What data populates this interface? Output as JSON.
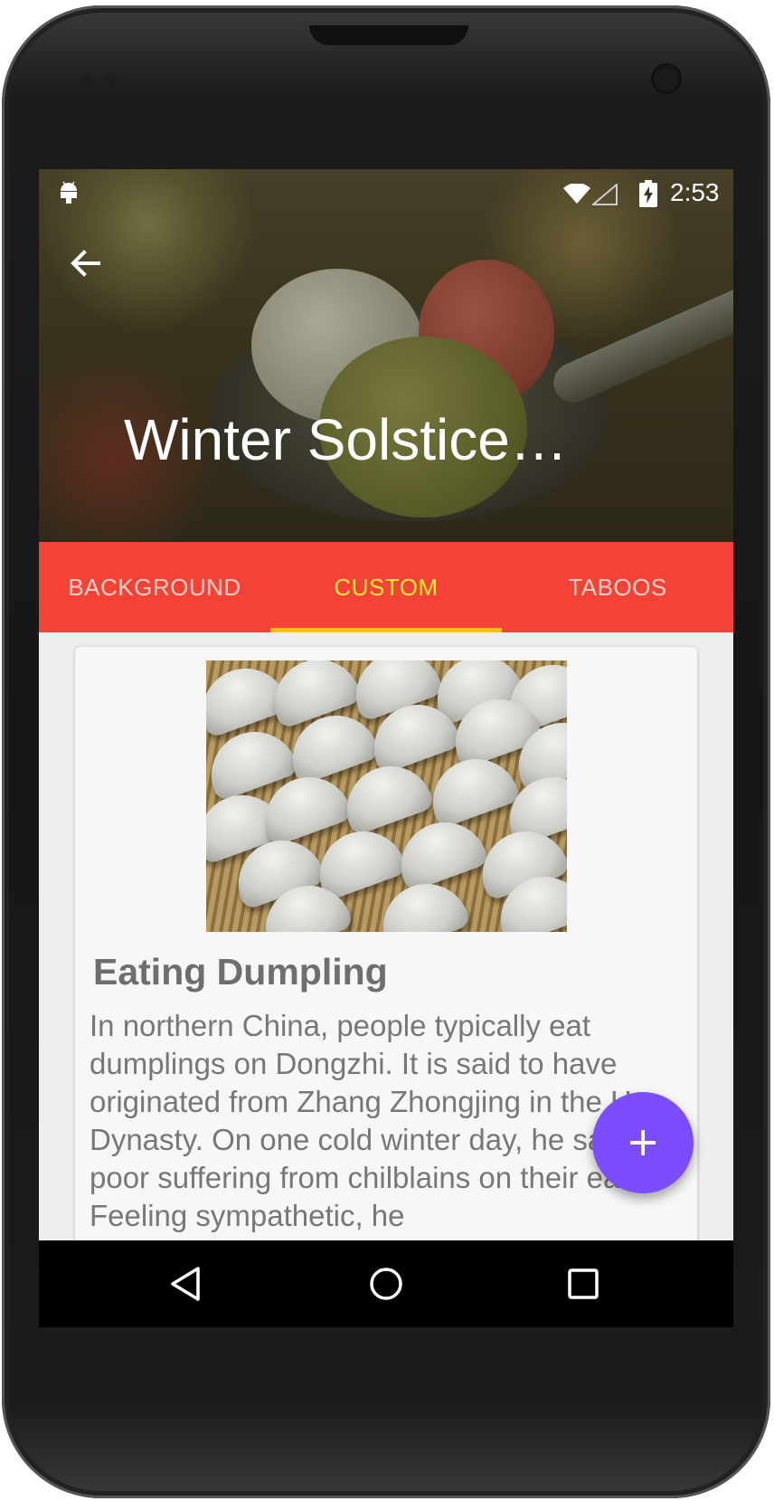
{
  "status_bar": {
    "time": "2:53"
  },
  "header": {
    "title": "Winter Solstice…"
  },
  "tabs": [
    {
      "label": "BACKGROUND",
      "active": false
    },
    {
      "label": "CUSTOM",
      "active": true
    },
    {
      "label": "TABOOS",
      "active": false
    }
  ],
  "card": {
    "title": "Eating Dumpling",
    "body": "In northern China, people typically eat dumplings on Dongzhi. It is said to have originated from Zhang Zhongjing in the Han Dynasty. On one cold winter day, he saw the poor suffering from chilblains on their ears. Feeling sympathetic, he"
  },
  "colors": {
    "primary": "#f44336",
    "accent": "#ffeb3b",
    "indicator": "#ffc107",
    "fab": "#7c4dff"
  },
  "icons": [
    "android-icon",
    "wifi-icon",
    "signal-icon",
    "battery-icon",
    "back-arrow-icon",
    "plus-icon",
    "nav-back-icon",
    "nav-home-icon",
    "nav-recents-icon"
  ]
}
